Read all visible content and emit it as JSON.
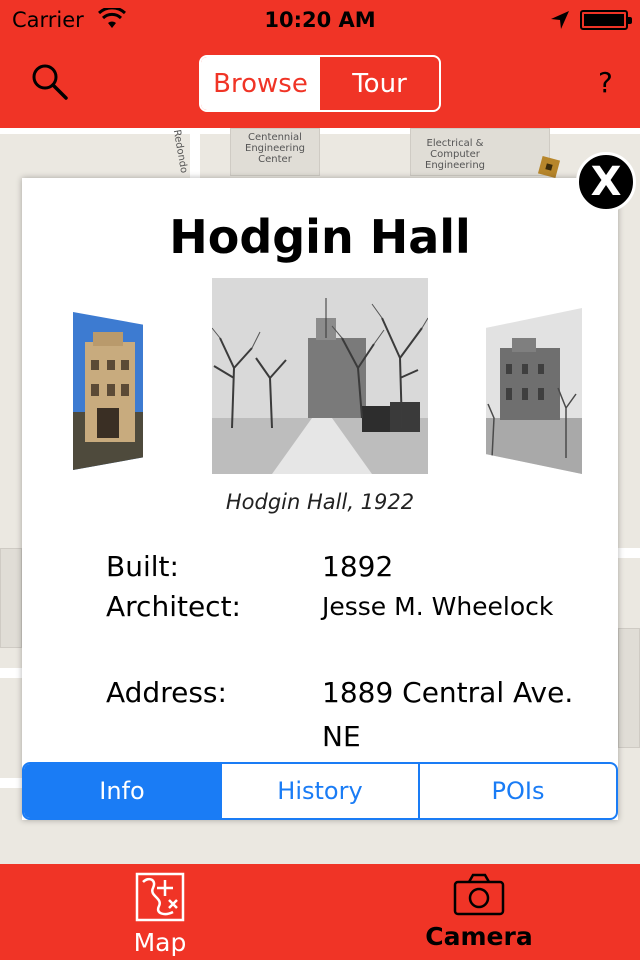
{
  "status_bar": {
    "carrier": "Carrier",
    "time": "10:20 AM"
  },
  "nav": {
    "segments": [
      {
        "label": "Browse",
        "active": true
      },
      {
        "label": "Tour",
        "active": false
      }
    ],
    "help_label": "?"
  },
  "map": {
    "labels": {
      "centennial": "Centennial Engineering Center",
      "electrical": "Electrical & Computer Engineering",
      "redondo": "Redondo"
    }
  },
  "popup": {
    "close_label": "X",
    "title": "Hodgin Hall",
    "caption": "Hodgin Hall, 1922",
    "details": {
      "built_label": "Built:",
      "built_value": "1892",
      "architect_label": "Architect:",
      "architect_value": "Jesse M. Wheelock",
      "address_label": "Address:",
      "address_line1": "1889 Central Ave.",
      "address_line2": "NE"
    },
    "tabs": [
      {
        "label": "Info",
        "active": true
      },
      {
        "label": "History",
        "active": false
      },
      {
        "label": "POIs",
        "active": false
      }
    ]
  },
  "tab_bar": {
    "map_label": "Map",
    "camera_label": "Camera"
  },
  "colors": {
    "brand_red": "#f03426",
    "accent_blue": "#1a7cf5"
  }
}
